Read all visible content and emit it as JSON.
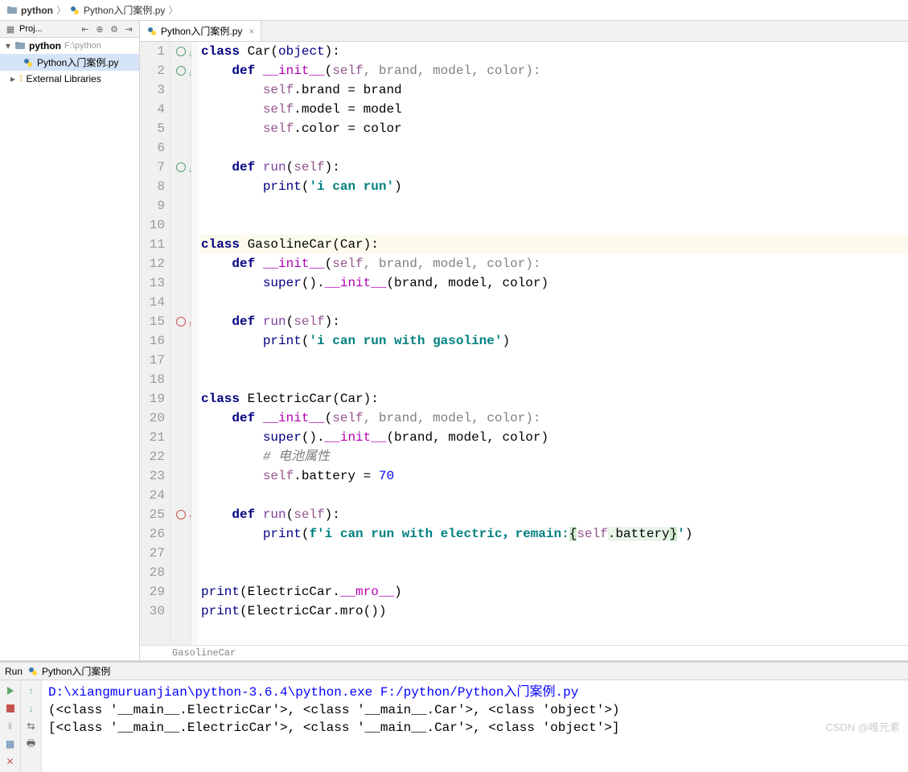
{
  "breadcrumb": {
    "items": [
      "python",
      "Python入门案例.py"
    ]
  },
  "project_panel": {
    "header": "Proj...",
    "root_name": "python",
    "root_path": "F:\\python",
    "file": "Python入门案例.py",
    "external": "External Libraries"
  },
  "editor": {
    "tab_name": "Python入门案例.py",
    "status_context": "GasolineCar",
    "line_numbers": [
      "1",
      "2",
      "3",
      "4",
      "5",
      "6",
      "7",
      "8",
      "9",
      "10",
      "11",
      "12",
      "13",
      "14",
      "15",
      "16",
      "17",
      "18",
      "19",
      "20",
      "21",
      "22",
      "23",
      "24",
      "25",
      "26",
      "27",
      "28",
      "29",
      "30"
    ],
    "gutter_markers": {
      "1": "circle-down",
      "2": "circle-down",
      "7": "circle-down",
      "15": "override-up",
      "25": "override-up"
    },
    "code_tokens": [
      [
        {
          "t": "class ",
          "c": "kw"
        },
        {
          "t": "Car",
          "c": ""
        },
        {
          "t": "(",
          "c": ""
        },
        {
          "t": "object",
          "c": "builtin"
        },
        {
          "t": "):",
          "c": ""
        }
      ],
      [
        {
          "t": "    ",
          "c": ""
        },
        {
          "t": "def ",
          "c": "kw"
        },
        {
          "t": "__init__",
          "c": "magic"
        },
        {
          "t": "(",
          "c": ""
        },
        {
          "t": "self",
          "c": "self"
        },
        {
          "t": ", brand, model, color):",
          "c": "param"
        }
      ],
      [
        {
          "t": "        ",
          "c": ""
        },
        {
          "t": "self",
          "c": "self"
        },
        {
          "t": ".brand = brand",
          "c": ""
        }
      ],
      [
        {
          "t": "        ",
          "c": ""
        },
        {
          "t": "self",
          "c": "self"
        },
        {
          "t": ".model = model",
          "c": ""
        }
      ],
      [
        {
          "t": "        ",
          "c": ""
        },
        {
          "t": "self",
          "c": "self"
        },
        {
          "t": ".color = color",
          "c": ""
        }
      ],
      [],
      [
        {
          "t": "    ",
          "c": ""
        },
        {
          "t": "def ",
          "c": "kw"
        },
        {
          "t": "run",
          "c": "fn"
        },
        {
          "t": "(",
          "c": ""
        },
        {
          "t": "self",
          "c": "self"
        },
        {
          "t": "):",
          "c": ""
        }
      ],
      [
        {
          "t": "        ",
          "c": ""
        },
        {
          "t": "print",
          "c": "builtin"
        },
        {
          "t": "(",
          "c": ""
        },
        {
          "t": "'i can run'",
          "c": "str"
        },
        {
          "t": ")",
          "c": ""
        }
      ],
      [],
      [],
      [
        {
          "t": "class ",
          "c": "kw"
        },
        {
          "t": "GasolineCar",
          "c": ""
        },
        {
          "t": "(Car):",
          "c": ""
        }
      ],
      [
        {
          "t": "    ",
          "c": ""
        },
        {
          "t": "def ",
          "c": "kw"
        },
        {
          "t": "__init__",
          "c": "magic"
        },
        {
          "t": "(",
          "c": ""
        },
        {
          "t": "self",
          "c": "self"
        },
        {
          "t": ", brand, model, color):",
          "c": "param"
        }
      ],
      [
        {
          "t": "        ",
          "c": ""
        },
        {
          "t": "super",
          "c": "builtin"
        },
        {
          "t": "().",
          "c": ""
        },
        {
          "t": "__init__",
          "c": "magic"
        },
        {
          "t": "(brand, model, color)",
          "c": ""
        }
      ],
      [],
      [
        {
          "t": "    ",
          "c": ""
        },
        {
          "t": "def ",
          "c": "kw"
        },
        {
          "t": "run",
          "c": "fn"
        },
        {
          "t": "(",
          "c": ""
        },
        {
          "t": "self",
          "c": "self"
        },
        {
          "t": "):",
          "c": ""
        }
      ],
      [
        {
          "t": "        ",
          "c": ""
        },
        {
          "t": "print",
          "c": "builtin"
        },
        {
          "t": "(",
          "c": ""
        },
        {
          "t": "'i can run with gasoline'",
          "c": "str"
        },
        {
          "t": ")",
          "c": ""
        }
      ],
      [],
      [],
      [
        {
          "t": "class ",
          "c": "kw"
        },
        {
          "t": "ElectricCar",
          "c": ""
        },
        {
          "t": "(Car):",
          "c": ""
        }
      ],
      [
        {
          "t": "    ",
          "c": ""
        },
        {
          "t": "def ",
          "c": "kw"
        },
        {
          "t": "__init__",
          "c": "magic"
        },
        {
          "t": "(",
          "c": ""
        },
        {
          "t": "self",
          "c": "self"
        },
        {
          "t": ", brand, model, color):",
          "c": "param"
        }
      ],
      [
        {
          "t": "        ",
          "c": ""
        },
        {
          "t": "super",
          "c": "builtin"
        },
        {
          "t": "().",
          "c": ""
        },
        {
          "t": "__init__",
          "c": "magic"
        },
        {
          "t": "(brand, model, color)",
          "c": ""
        }
      ],
      [
        {
          "t": "        ",
          "c": ""
        },
        {
          "t": "# 电池属性",
          "c": "comment"
        }
      ],
      [
        {
          "t": "        ",
          "c": ""
        },
        {
          "t": "self",
          "c": "self"
        },
        {
          "t": ".battery = ",
          "c": ""
        },
        {
          "t": "70",
          "c": "num"
        }
      ],
      [],
      [
        {
          "t": "    ",
          "c": ""
        },
        {
          "t": "def ",
          "c": "kw"
        },
        {
          "t": "run",
          "c": "fn"
        },
        {
          "t": "(",
          "c": ""
        },
        {
          "t": "self",
          "c": "self"
        },
        {
          "t": "):",
          "c": ""
        }
      ],
      [
        {
          "t": "        ",
          "c": ""
        },
        {
          "t": "print",
          "c": "builtin"
        },
        {
          "t": "(",
          "c": ""
        },
        {
          "t": "f'i can run with electric，remain:",
          "c": "str"
        },
        {
          "t": "{",
          "c": "fstr-brace"
        },
        {
          "t": "self",
          "c": "self"
        },
        {
          "t": ".battery",
          "c": "fstr-expr"
        },
        {
          "t": "}",
          "c": "fstr-brace"
        },
        {
          "t": "'",
          "c": "str"
        },
        {
          "t": ")",
          "c": ""
        }
      ],
      [],
      [],
      [
        {
          "t": "print",
          "c": "builtin"
        },
        {
          "t": "(ElectricCar.",
          "c": ""
        },
        {
          "t": "__mro__",
          "c": "magic"
        },
        {
          "t": ")",
          "c": ""
        }
      ],
      [
        {
          "t": "print",
          "c": "builtin"
        },
        {
          "t": "(ElectricCar.mro())",
          "c": ""
        }
      ]
    ],
    "highlight_line": 11
  },
  "run": {
    "label": "Run",
    "config": "Python入门案例",
    "output": [
      {
        "text": "D:\\xiangmuruanjian\\python-3.6.4\\python.exe F:/python/Python入门案例.py",
        "cls": "path-blue"
      },
      {
        "text": "(<class '__main__.ElectricCar'>, <class '__main__.Car'>, <class 'object'>)",
        "cls": ""
      },
      {
        "text": "[<class '__main__.ElectricCar'>, <class '__main__.Car'>, <class 'object'>]",
        "cls": ""
      }
    ]
  },
  "watermark": "CSDN @唯元素"
}
